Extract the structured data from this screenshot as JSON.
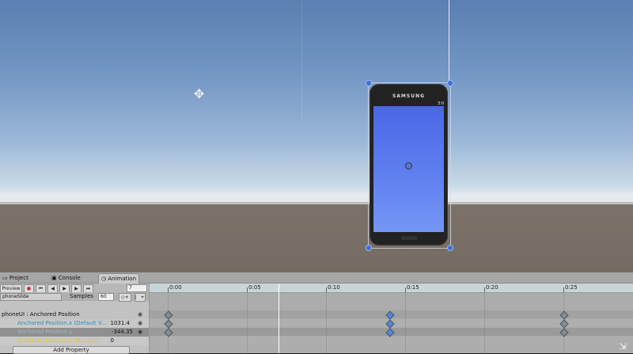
{
  "scene": {
    "tool_icon": "move-tool-icon",
    "phone_brand": "SAMSUNG",
    "phone_status": "3:0"
  },
  "tabs": [
    {
      "label": "Project",
      "icon": "folder-icon"
    },
    {
      "label": "Console",
      "icon": "console-icon"
    },
    {
      "label": "Animation",
      "icon": "clock-icon"
    }
  ],
  "controls": {
    "preview_label": "Preview",
    "frame_value": "7",
    "clip_name": "phoneSlide",
    "samples_label": "Samples",
    "samples_value": "60"
  },
  "properties": {
    "group_label": "phoneUI : Anchored Position",
    "items": [
      {
        "label": "Anchored Position.x (Default V...",
        "value": "1031.4"
      },
      {
        "label": "Anchored Position.y",
        "value": "-344.35"
      },
      {
        "label": "Anchored Position.z (Missing)",
        "value": "0"
      }
    ],
    "add_property_label": "Add Property"
  },
  "timeline": {
    "ticks": [
      "0:00",
      "0:05",
      "0:10",
      "0:15",
      "0:20",
      "0:25"
    ],
    "keyframes_at": [
      "0:00",
      "0:14",
      "0:25"
    ],
    "playhead_time": "0:07"
  },
  "colors": {
    "keyframe": "#7f8d9a",
    "keyframe_selected": "#4f86e0",
    "property_x": "#2f8fb5",
    "property_y": "#3a8fb0",
    "property_missing": "#e0c93a"
  }
}
